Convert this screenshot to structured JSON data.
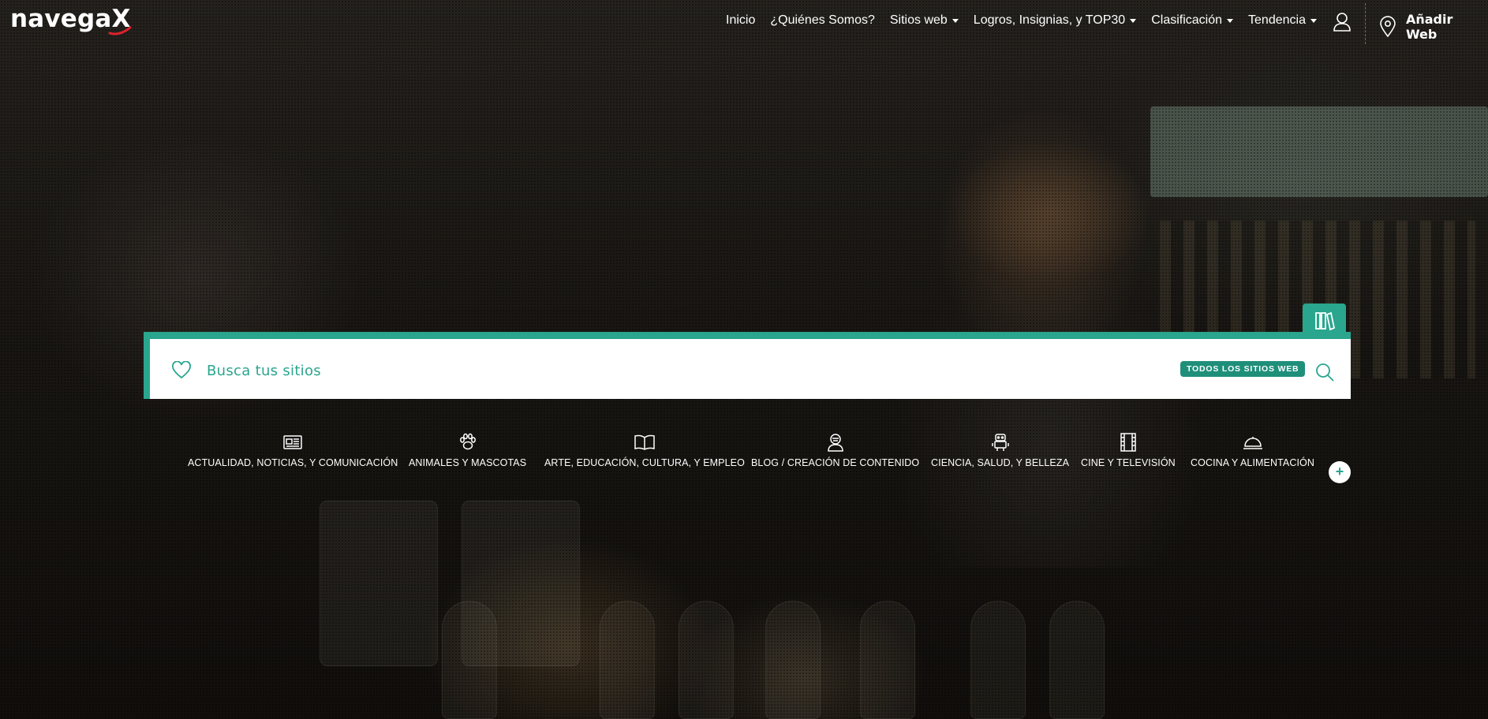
{
  "brand": {
    "logo_text": "navega",
    "logo_x": "X"
  },
  "nav": {
    "items": [
      {
        "label": "Inicio",
        "dropdown": false
      },
      {
        "label": "¿Quiénes Somos?",
        "dropdown": false
      },
      {
        "label": "Sitios web",
        "dropdown": true
      },
      {
        "label": "Logros, Insignias, y TOP30",
        "dropdown": true
      },
      {
        "label": "Clasificación",
        "dropdown": true
      },
      {
        "label": "Tendencia",
        "dropdown": true
      }
    ],
    "user_icon": "user-icon",
    "add_web_icon": "map-pin-icon",
    "add_web_label": "Añadir Web"
  },
  "search": {
    "placeholder": "Busca tus sitios",
    "value": "",
    "scope": "TODOS LOS SITIOS WEB",
    "tab_icon": "books-icon",
    "left_icon": "heart-icon",
    "button_icon": "search-icon",
    "accent": "#2aa58e"
  },
  "categories": [
    {
      "label": "ACTUALIDAD, NOTICIAS, Y COMUNICACIÓN",
      "icon": "newspaper-icon"
    },
    {
      "label": "ANIMALES Y MASCOTAS",
      "icon": "paw-icon"
    },
    {
      "label": "ARTE, EDUCACIÓN, CULTURA, Y EMPLEO",
      "icon": "open-book-icon"
    },
    {
      "label": "BLOG / CREACIÓN DE CONTENIDO",
      "icon": "blogger-icon"
    },
    {
      "label": "CIENCIA, SALUD, Y BELLEZA",
      "icon": "robot-icon"
    },
    {
      "label": "CINE Y TELEVISIÓN",
      "icon": "film-icon"
    },
    {
      "label": "COCINA Y ALIMENTACIÓN",
      "icon": "cloche-icon"
    }
  ],
  "more_label": "+"
}
